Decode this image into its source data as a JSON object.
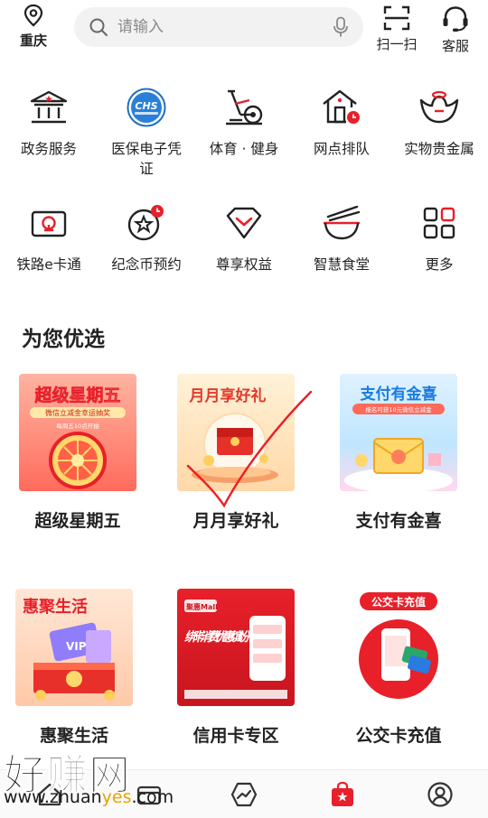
{
  "header": {
    "location": "重庆",
    "search_placeholder": "请输入",
    "scan_label": "扫一扫",
    "service_label": "客服"
  },
  "services": [
    {
      "label": "政务服务",
      "icon": "government-building-icon"
    },
    {
      "label": "医保电子凭证",
      "icon": "chs-medical-insurance-logo"
    },
    {
      "label": "体育 · 健身",
      "icon": "elliptical-trainer-icon"
    },
    {
      "label": "网点排队",
      "icon": "branch-queue-icon"
    },
    {
      "label": "实物贵金属",
      "icon": "gold-ingot-icon"
    },
    {
      "label": "铁路e卡通",
      "icon": "railway-card-icon"
    },
    {
      "label": "纪念币预约",
      "icon": "commemorative-coin-icon"
    },
    {
      "label": "尊享权益",
      "icon": "diamond-benefits-icon"
    },
    {
      "label": "智慧食堂",
      "icon": "canteen-bowl-icon"
    },
    {
      "label": "更多",
      "icon": "more-grid-icon"
    }
  ],
  "chs_logo_text": "CHS",
  "section_title": "为您优选",
  "cards": [
    {
      "label": "超级星期五",
      "banner": "超级星期五",
      "sub": "微信立减金幸运抽奖",
      "sub2": "每周五10点开抽"
    },
    {
      "label": "月月享好礼",
      "banner": "月月享好礼"
    },
    {
      "label": "支付有金喜",
      "banner": "支付有金喜",
      "sub": "报名可获10元微信立减金"
    },
    {
      "label": "惠聚生活",
      "banner": "惠聚生活",
      "sub": "VIP"
    },
    {
      "label": "信用卡专区",
      "banner": "绑卡消费 优惠缤纷",
      "sub": "聚惠Mall"
    },
    {
      "label": "公交卡充值",
      "banner": "公交卡充值"
    }
  ],
  "bottom_nav": [
    {
      "icon": "home-icon"
    },
    {
      "icon": "wallet-icon"
    },
    {
      "icon": "wealth-trend-icon"
    },
    {
      "icon": "life-bag-icon",
      "active": true
    },
    {
      "icon": "profile-icon"
    }
  ],
  "watermark": {
    "big": "好赚网",
    "url_a": "www.zhuan",
    "url_b": "yes",
    "url_c": ".com"
  },
  "colors": {
    "accent": "#e8202a",
    "text": "#222222",
    "search_bg": "#f2f2f2"
  }
}
